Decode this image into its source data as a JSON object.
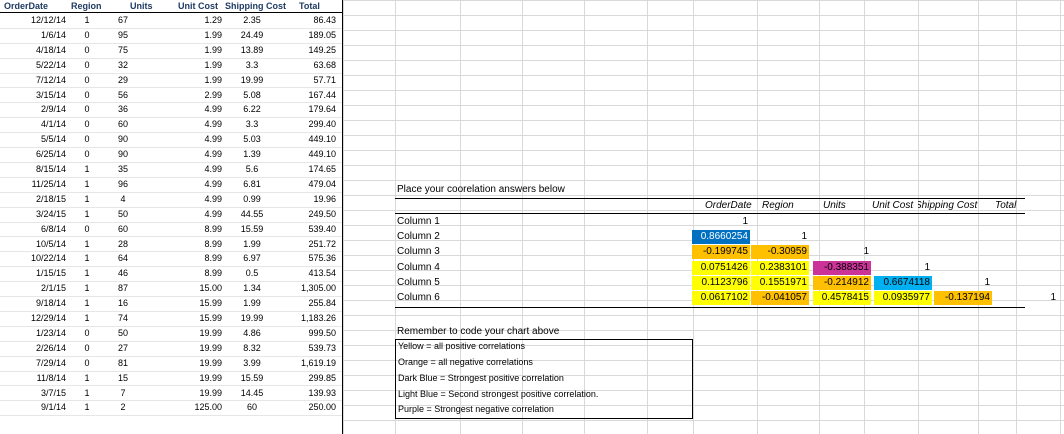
{
  "sheet": {
    "headers": {
      "order_date": "OrderDate",
      "region": "Region",
      "units": "Units",
      "unit_cost": "Unit Cost",
      "shipping_cost": "Shipping Cost",
      "total": "Total"
    },
    "rows": [
      [
        "12/12/14",
        "1",
        "67",
        "1.29",
        "2.35",
        "86.43"
      ],
      [
        "1/6/14",
        "0",
        "95",
        "1.99",
        "24.49",
        "189.05"
      ],
      [
        "4/18/14",
        "0",
        "75",
        "1.99",
        "13.89",
        "149.25"
      ],
      [
        "5/22/14",
        "0",
        "32",
        "1.99",
        "3.3",
        "63.68"
      ],
      [
        "7/12/14",
        "0",
        "29",
        "1.99",
        "19.99",
        "57.71"
      ],
      [
        "3/15/14",
        "0",
        "56",
        "2.99",
        "5.08",
        "167.44"
      ],
      [
        "2/9/14",
        "0",
        "36",
        "4.99",
        "6.22",
        "179.64"
      ],
      [
        "4/1/14",
        "0",
        "60",
        "4.99",
        "3.3",
        "299.40"
      ],
      [
        "5/5/14",
        "0",
        "90",
        "4.99",
        "5.03",
        "449.10"
      ],
      [
        "6/25/14",
        "0",
        "90",
        "4.99",
        "1.39",
        "449.10"
      ],
      [
        "8/15/14",
        "1",
        "35",
        "4.99",
        "5.6",
        "174.65"
      ],
      [
        "11/25/14",
        "1",
        "96",
        "4.99",
        "6.81",
        "479.04"
      ],
      [
        "2/18/15",
        "1",
        "4",
        "4.99",
        "0.99",
        "19.96"
      ],
      [
        "3/24/15",
        "1",
        "50",
        "4.99",
        "44.55",
        "249.50"
      ],
      [
        "6/8/14",
        "0",
        "60",
        "8.99",
        "15.59",
        "539.40"
      ],
      [
        "10/5/14",
        "1",
        "28",
        "8.99",
        "1.99",
        "251.72"
      ],
      [
        "10/22/14",
        "1",
        "64",
        "8.99",
        "6.97",
        "575.36"
      ],
      [
        "1/15/15",
        "1",
        "46",
        "8.99",
        "0.5",
        "413.54"
      ],
      [
        "2/1/15",
        "1",
        "87",
        "15.00",
        "1.34",
        "1,305.00"
      ],
      [
        "9/18/14",
        "1",
        "16",
        "15.99",
        "1.99",
        "255.84"
      ],
      [
        "12/29/14",
        "1",
        "74",
        "15.99",
        "19.99",
        "1,183.26"
      ],
      [
        "1/23/14",
        "0",
        "50",
        "19.99",
        "4.86",
        "999.50"
      ],
      [
        "2/26/14",
        "0",
        "27",
        "19.99",
        "8.32",
        "539.73"
      ],
      [
        "7/29/14",
        "0",
        "81",
        "19.99",
        "3.99",
        "1,619.19"
      ],
      [
        "11/8/14",
        "1",
        "15",
        "19.99",
        "15.59",
        "299.85"
      ],
      [
        "3/7/15",
        "1",
        "7",
        "19.99",
        "14.45",
        "139.93"
      ],
      [
        "9/1/14",
        "1",
        "2",
        "125.00",
        "60",
        "250.00"
      ]
    ]
  },
  "correlation": {
    "title": "Place your coorelation answers below",
    "headers": [
      "OrderDate",
      "Region",
      "Units",
      "Unit Cost",
      "Shipping Cost",
      "Total"
    ],
    "row_labels": [
      "Column 1",
      "Column 2",
      "Column 3",
      "Column 4",
      "Column 5",
      "Column 6"
    ],
    "matrix": [
      [
        "1",
        "",
        "",
        "",
        "",
        ""
      ],
      [
        "0.8660254",
        "1",
        "",
        "",
        "",
        ""
      ],
      [
        "-0.199745",
        "-0.30959",
        "1",
        "",
        "",
        ""
      ],
      [
        "0.0751426",
        "0.2383101",
        "-0.388351",
        "1",
        "",
        ""
      ],
      [
        "0.1123796",
        "0.1551971",
        "-0.214912",
        "0.6674118",
        "1",
        ""
      ],
      [
        "0.0617102",
        "-0.041057",
        "0.4578415",
        "0.0935977",
        "-0.137194",
        "1"
      ]
    ],
    "colors": {
      "yellow": "#ffff00",
      "orange": "#ffc000",
      "dark_blue": "#0070c0",
      "light_blue": "#00b0f0",
      "purple": "#cc3399"
    }
  },
  "legend": {
    "title": "Remember to code your chart above",
    "items": [
      "Yellow = all positive correlations",
      "Orange = all negative correlations",
      "Dark Blue = Strongest positive correlation",
      "Light Blue = Second strongest positive correlation.",
      "Purple = Strongest negative correlation"
    ]
  }
}
